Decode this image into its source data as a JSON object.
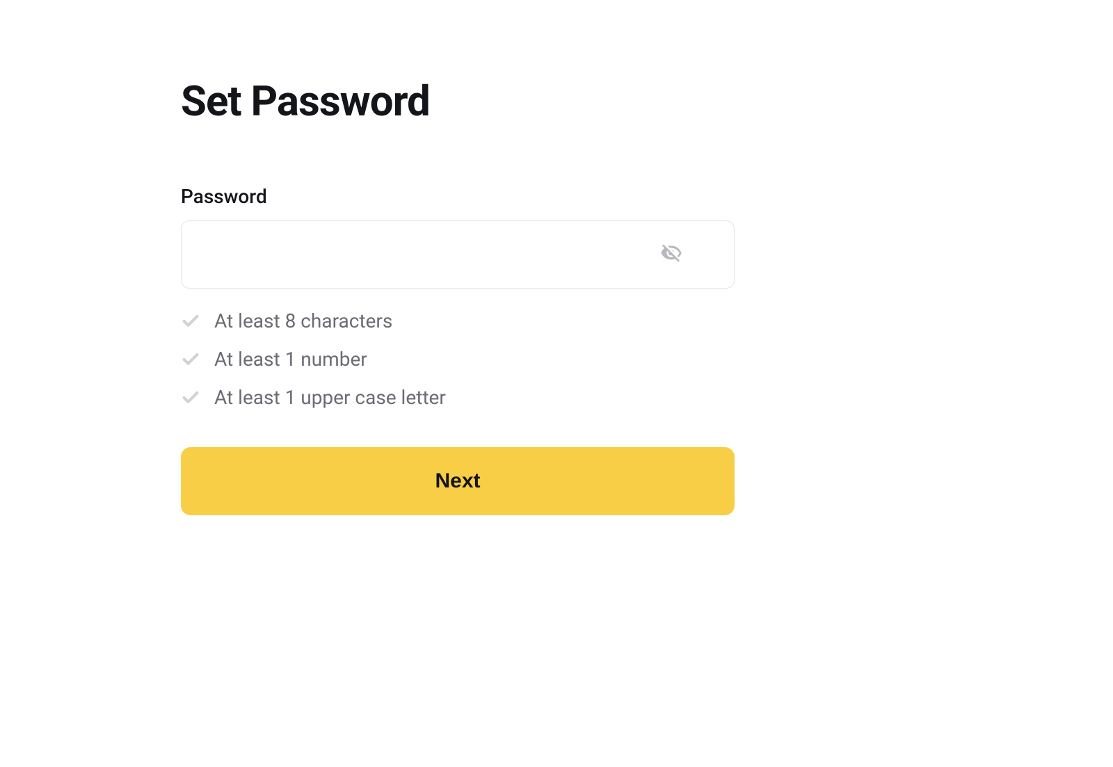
{
  "page": {
    "title": "Set Password"
  },
  "form": {
    "password_label": "Password",
    "password_value": "",
    "password_placeholder": ""
  },
  "requirements": [
    {
      "text": "At least 8 characters",
      "met": false
    },
    {
      "text": "At least 1 number",
      "met": false
    },
    {
      "text": "At least 1 upper case letter",
      "met": false
    }
  ],
  "actions": {
    "next_label": "Next"
  },
  "colors": {
    "accent": "#f7ce46",
    "text_primary": "#14151a",
    "text_secondary": "#6b6b74",
    "icon_muted": "#d1d1d6",
    "border": "#e4e4e7"
  }
}
